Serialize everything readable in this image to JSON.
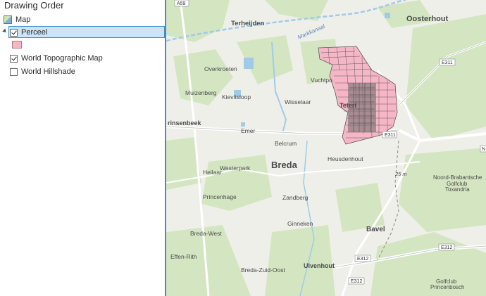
{
  "panel": {
    "title": "Drawing Order",
    "map_label": "Map",
    "layers": [
      {
        "label": "Perceel",
        "checked": true,
        "selected": true,
        "symbol_color": "#f6b6c6"
      },
      {
        "label": "World Topographic Map",
        "checked": true
      },
      {
        "label": "World Hillshade",
        "checked": false
      }
    ]
  },
  "map": {
    "places": {
      "oosterhout": "Oosterhout",
      "terheijden": "Terheijden",
      "markkanaal": "Markkanaal",
      "overkroeten": "Overkroeten",
      "vuchtpolder": "Vuchtpo",
      "muizenberg": "Muizenberg",
      "kievitsloop": "Kievitsloop",
      "wisselaar": "Wisselaar",
      "teteringen": "Teteri",
      "prinsenbeek": "rinsenbeek",
      "emer": "Emer",
      "belcrum": "Belcrum",
      "heusdenhout": "Heusdenhout",
      "heilaar": "Heilaar",
      "westerpark": "Westerpark",
      "breda": "Breda",
      "noord_brabantse": "Noord-Brabantsche",
      "golfclub_toxandria_1": "Golfclub",
      "golfclub_toxandria_2": "Toxandria",
      "princenhage": "Princenhage",
      "zandberg": "Zandberg",
      "ginneken": "Ginneken",
      "bavel": "Bavel",
      "breda_west": "Breda-West",
      "effen_rith": "Effen-Rith",
      "ulvenhout": "Ulvenhout",
      "breda_zuid_oost": "Breda-Zuid-Oost",
      "golfclub_princenbosch_1": "Golfclub",
      "golfclub_princenbosch_2": "Princenbosch",
      "elevation": "25 m"
    },
    "shields": {
      "a59": "A59",
      "e311_top": "E311",
      "e311_mid": "E311",
      "e312_right": "E312",
      "e312_bottom": "E312",
      "e312_low": "E312",
      "n_edge": "N"
    },
    "colors": {
      "land": "#efefe9",
      "green": "#d4e6c1",
      "water": "#9fcbe9",
      "road": "#ffffff",
      "parcel_fill": "#f6b6c6",
      "parcel_line": "#5a5a5a",
      "selection": "#cde4f7",
      "divider": "#3b8ed6"
    }
  }
}
